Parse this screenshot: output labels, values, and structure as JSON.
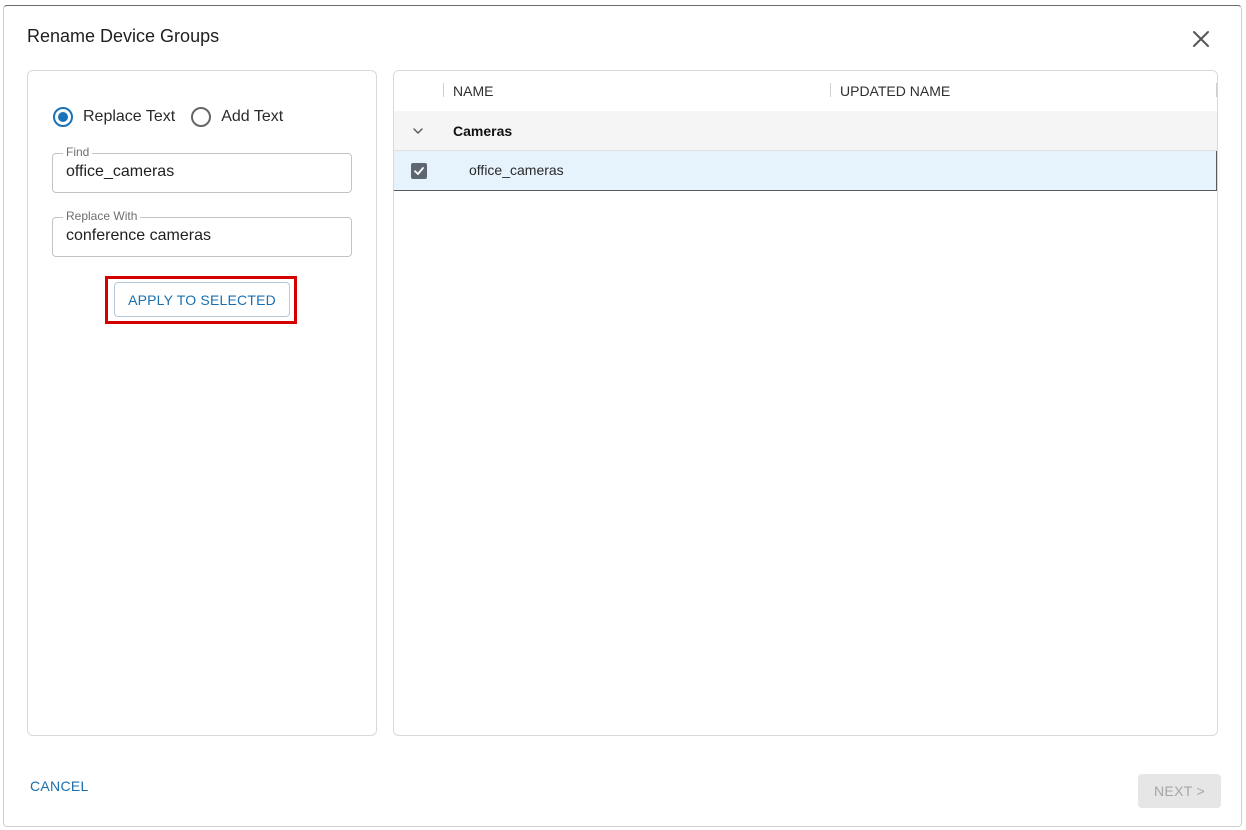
{
  "dialog": {
    "title": "Rename Device Groups"
  },
  "mode": {
    "options": [
      {
        "label": "Replace Text",
        "selected": true
      },
      {
        "label": "Add Text",
        "selected": false
      }
    ]
  },
  "find": {
    "label": "Find",
    "value": "office_cameras"
  },
  "replace": {
    "label": "Replace With",
    "value": "conference cameras"
  },
  "actions": {
    "apply_label": "APPLY TO SELECTED",
    "cancel_label": "CANCEL",
    "next_label": "NEXT >"
  },
  "table": {
    "columns": [
      "NAME",
      "UPDATED NAME"
    ],
    "groups": [
      {
        "name": "Cameras",
        "expanded": true,
        "items": [
          {
            "name": "office_cameras",
            "updated_name": "",
            "checked": true
          }
        ]
      }
    ]
  },
  "colors": {
    "accent": "#1a73b8",
    "highlight": "#d40000",
    "selected_row": "#e7f3fc",
    "disabled_bg": "#e6e6e6"
  }
}
